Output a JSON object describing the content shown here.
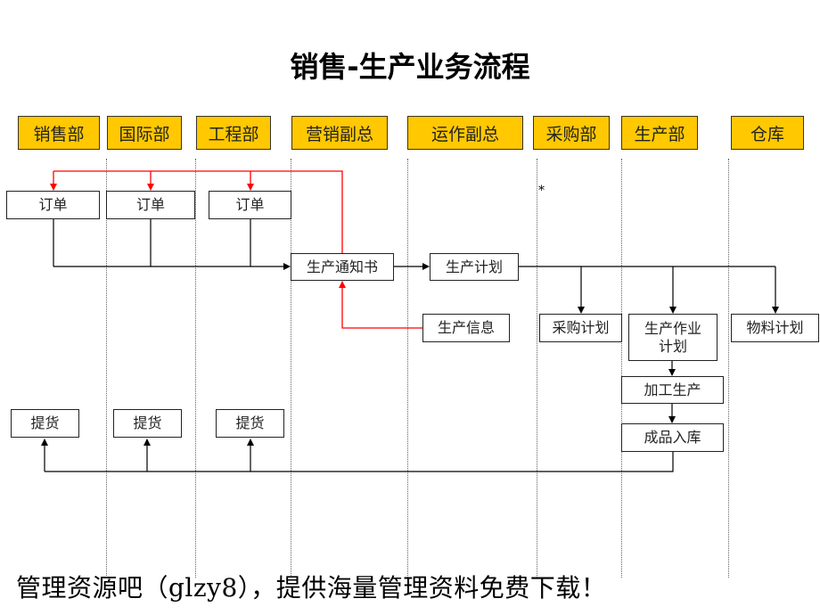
{
  "title": "销售-生产业务流程",
  "lanes": [
    {
      "label": "销售部"
    },
    {
      "label": "国际部"
    },
    {
      "label": "工程部"
    },
    {
      "label": "营销副总"
    },
    {
      "label": "运作副总"
    },
    {
      "label": "采购部"
    },
    {
      "label": "生产部"
    },
    {
      "label": "仓库"
    }
  ],
  "nodes": {
    "order1": "订单",
    "order2": "订单",
    "order3": "订单",
    "production_notice": "生产通知书",
    "production_plan": "生产计划",
    "production_info": "生产信息",
    "purchase_plan": "采购计划",
    "production_work_plan": "生产作业计划",
    "material_plan": "物料计划",
    "processing": "加工生产",
    "finished_storage": "成品入库",
    "pickup1": "提货",
    "pickup2": "提货",
    "pickup3": "提货"
  },
  "marker": "*",
  "colors": {
    "lane_header": "#ffc800",
    "feedback_line": "#ff0000",
    "flow_line": "#000000"
  },
  "footer": "管理资源吧（glzy8），提供海量管理资料免费下载！"
}
